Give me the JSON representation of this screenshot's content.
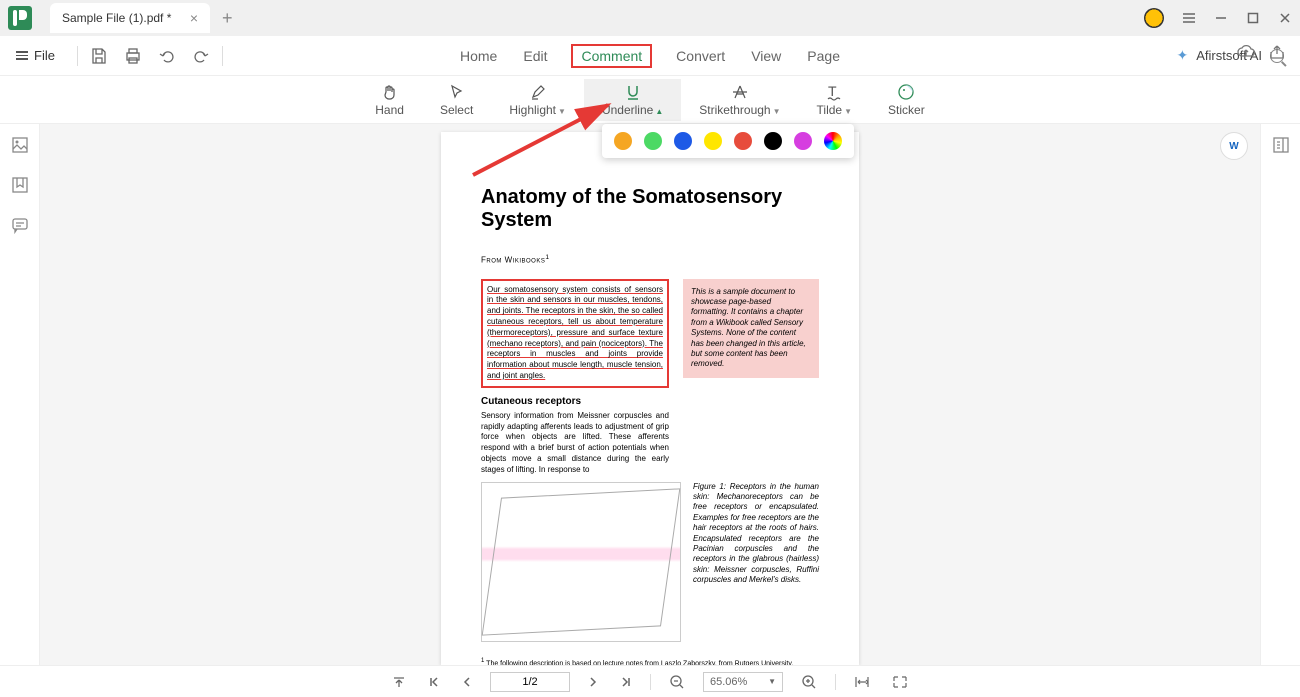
{
  "titleBar": {
    "tabName": "Sample File (1).pdf *"
  },
  "menuBar": {
    "fileLabel": "File",
    "tabs": [
      "Home",
      "Edit",
      "Comment",
      "Convert",
      "View",
      "Page"
    ],
    "activeTab": "Comment",
    "aiLabel": "Afirstsoft AI"
  },
  "toolBar": {
    "tools": [
      "Hand",
      "Select",
      "Highlight",
      "Underline",
      "Strikethrough",
      "Tilde",
      "Sticker"
    ],
    "activeTool": "Underline"
  },
  "colorPopup": {
    "colors": [
      "#f5a623",
      "#4cd964",
      "#1e5ae6",
      "#ffe600",
      "#e74c3c",
      "#000000",
      "#d63ee0"
    ]
  },
  "document": {
    "title": "Anatomy of the Somatosensory System",
    "from": "From Wikibooks",
    "fromSup": "1",
    "underlinedParagraph": "Our somatosensory system consists of sensors in the skin and sensors in our muscles, tendons, and joints. The receptors in the skin, the so called cutaneous receptors, tell us about temperature (thermoreceptors), pressure and surface texture (mechano receptors), and pain (nociceptors). The receptors in muscles and joints provide information about muscle length, muscle tension, and joint angles.",
    "pinkBox": "This is a sample document to showcase page-based formatting. It contains a chapter from a Wikibook called Sensory Systems. None of the content has been changed in this article, but some content has been removed.",
    "subheading": "Cutaneous receptors",
    "bodyText": "Sensory information from Meissner corpuscles and rapidly adapting afferents leads to adjustment of grip force when objects are lifted. These afferents respond with a brief burst of action potentials when objects move a small distance during the early stages of lifting. In response to",
    "figCaption": "Figure 1: Receptors in the human skin: Mechanoreceptors can be free receptors or encapsulated. Examples for free receptors are the hair receptors at the roots of hairs. Encapsulated receptors are the Pacinian corpuscles and the receptors in the glabrous (hairless) skin: Meissner corpuscles, Ruffini corpuscles and Merkel's disks.",
    "footnote": "The following description is based on lecture notes from Laszlo Zaborszky, from Rutgers University.",
    "footnoteNum": "1",
    "pageNum": "1"
  },
  "statusBar": {
    "page": "1/2",
    "zoom": "65.06%"
  }
}
